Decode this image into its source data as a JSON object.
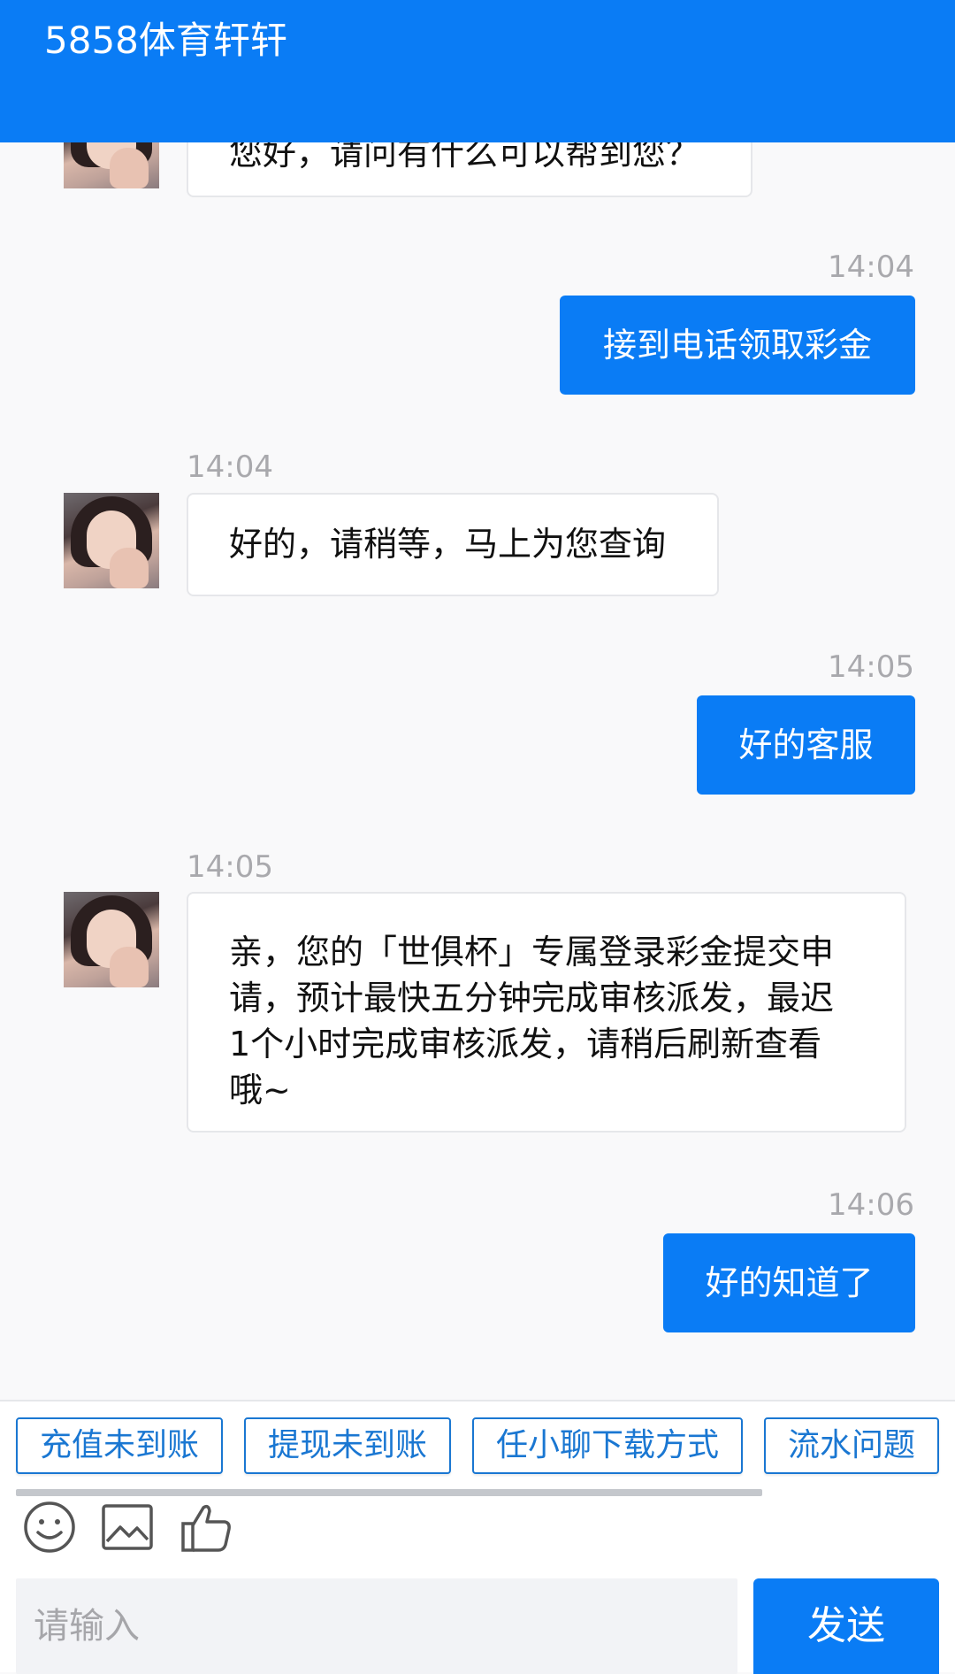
{
  "header": {
    "title": "5858体育轩轩"
  },
  "messages": {
    "m0": {
      "text": "您好，请问有什么可以帮到您？"
    },
    "m1": {
      "time": "14:04",
      "text": "接到电话领取彩金"
    },
    "m2": {
      "time": "14:04",
      "text": "好的，请稍等，马上为您查询"
    },
    "m3": {
      "time": "14:05",
      "text": "好的客服"
    },
    "m4": {
      "time": "14:05",
      "lines": [
        "亲，您的「世俱杯」专属登录彩金提交申",
        "请，预计最快五分钟完成审核派发，最迟",
        "1个小时完成审核派发，请稍后刷新查看",
        "哦~"
      ]
    },
    "m5": {
      "time": "14:06",
      "text": "好的知道了"
    }
  },
  "quick_replies": [
    "充值未到账",
    "提现未到账",
    "任小聊下载方式",
    "流水问题"
  ],
  "toolbar": {
    "icons": [
      "emoji-icon",
      "image-icon",
      "thumbs-up-icon"
    ]
  },
  "composer": {
    "placeholder": "请输入",
    "send_label": "发送"
  },
  "colors": {
    "primary": "#0a7cf5",
    "quick_reply_text": "#1a77d2",
    "timestamp": "#a9a9ad",
    "background": "#f9f9fa"
  }
}
